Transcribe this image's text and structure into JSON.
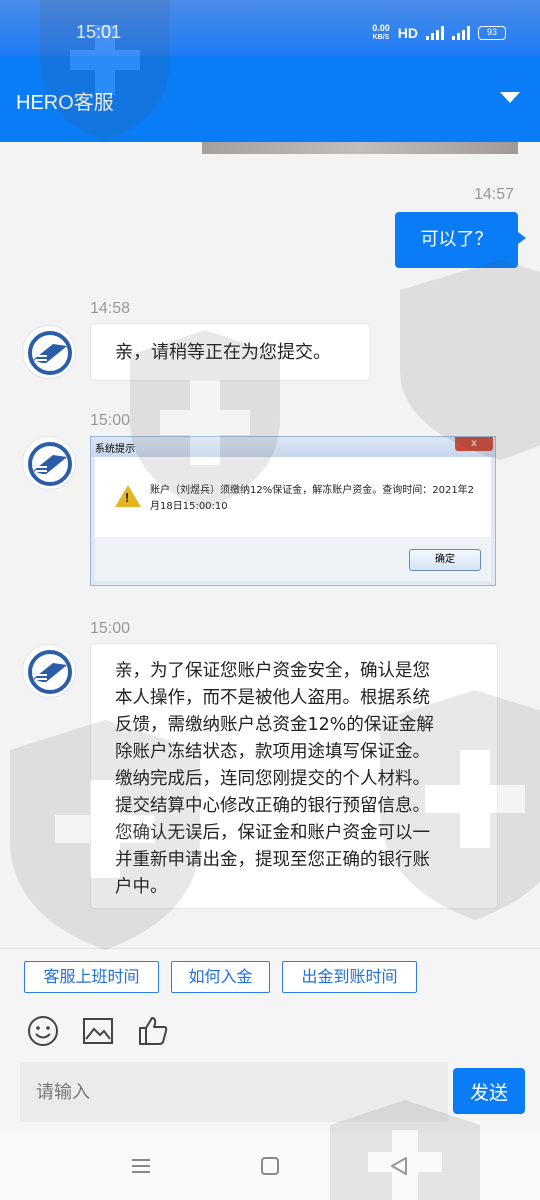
{
  "status_bar": {
    "time": "15:01",
    "net_speed_value": "0.00",
    "net_speed_unit": "KB/S",
    "hd_label": "HD",
    "battery": "93"
  },
  "header": {
    "title": "HERO客服",
    "dropdown_icon": "chevron-down-icon"
  },
  "messages": [
    {
      "type": "sent",
      "timestamp": "14:57",
      "text": "可以了？"
    },
    {
      "type": "received",
      "timestamp": "14:58",
      "text": "亲，请稍等正在为您提交。"
    },
    {
      "type": "received-image",
      "timestamp": "15:00",
      "dialog": {
        "title": "系统提示",
        "close_label": "x",
        "message": "账户（刘煜兵）须缴纳12%保证金，解冻账户资金。查询时间：2021年2月18日15:00:10",
        "ok_label": "确定"
      }
    },
    {
      "type": "received",
      "timestamp": "15:00",
      "lines": [
        "亲，为了保证您账户资金安全，确认是您",
        "本人操作，而不是被他人盗用。根据系统",
        "反馈，需缴纳账户总资金12%的保证金解",
        "除账户冻结状态，款项用途填写保证金。",
        "缴纳完成后，连同您刚提交的个人材料。",
        "提交结算中心修改正确的银行预留信息。",
        "您确认无误后，保证金和账户资金可以一",
        "并重新申请出金，提现至您正确的银行账",
        "户中。"
      ]
    }
  ],
  "quick_replies": [
    "客服上班时间",
    "如何入金",
    "出金到账时间"
  ],
  "tools": [
    "emoji-icon",
    "image-icon",
    "thumbs-up-icon"
  ],
  "input": {
    "placeholder": "请输入",
    "value": ""
  },
  "send_label": "发送",
  "nav": [
    "menu-icon",
    "home-icon",
    "back-icon"
  ],
  "colors": {
    "primary": "#0a7cf6",
    "warning": "#e6b526"
  }
}
